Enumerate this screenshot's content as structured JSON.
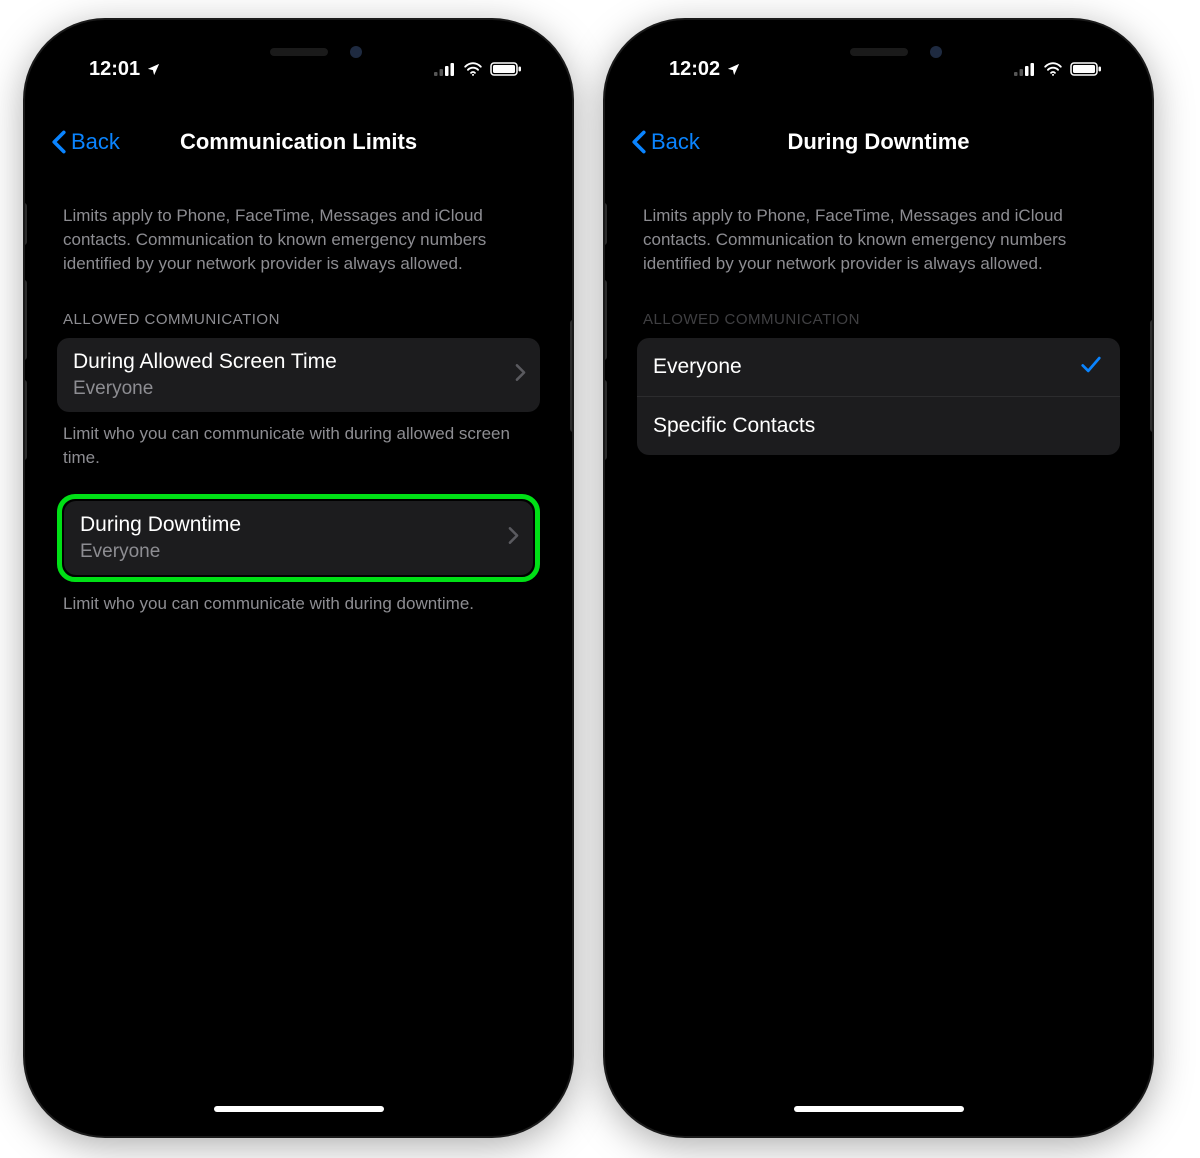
{
  "colors": {
    "accent": "#0a84ff",
    "highlight": "#00e016"
  },
  "phone_left": {
    "status": {
      "time": "12:01"
    },
    "nav": {
      "back_label": "Back",
      "title": "Communication Limits"
    },
    "intro": "Limits apply to Phone, FaceTime, Messages and iCloud contacts. Communication to known emergency numbers identified by your network provider is always allowed.",
    "section_header": "ALLOWED COMMUNICATION",
    "rows": {
      "screen_time": {
        "title": "During Allowed Screen Time",
        "value": "Everyone",
        "note": "Limit who you can communicate with during allowed screen time."
      },
      "downtime": {
        "title": "During Downtime",
        "value": "Everyone",
        "note": "Limit who you can communicate with during downtime."
      }
    }
  },
  "phone_right": {
    "status": {
      "time": "12:02"
    },
    "nav": {
      "back_label": "Back",
      "title": "During Downtime"
    },
    "intro": "Limits apply to Phone, FaceTime, Messages and iCloud contacts. Communication to known emergency numbers identified by your network provider is always allowed.",
    "section_header": "ALLOWED COMMUNICATION",
    "options": {
      "everyone": {
        "label": "Everyone",
        "selected": true
      },
      "specific": {
        "label": "Specific Contacts",
        "selected": false
      }
    }
  }
}
